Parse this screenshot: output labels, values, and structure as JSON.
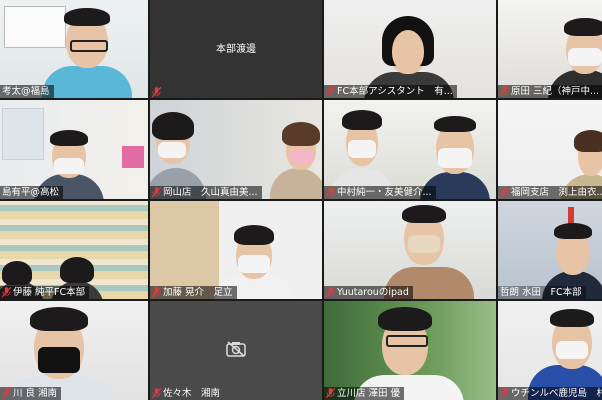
{
  "participants": [
    {
      "name": "考太@福島",
      "active": true
    },
    {
      "name": "本部渡邊",
      "camera_off_name_center": true
    },
    {
      "name": "FC本部アシスタント　有..."
    },
    {
      "name": "原田 三紀（神戸中..."
    },
    {
      "name": "島有平@高松"
    },
    {
      "name": "岡山店　久山真由美..."
    },
    {
      "name": "中村純一・友美健介..."
    },
    {
      "name": "福岡支店　渕上由衣..."
    },
    {
      "name": "伊藤 純平FC本部"
    },
    {
      "name": "加藤 晃介　足立"
    },
    {
      "name": "Yuutarouのipad"
    },
    {
      "name": "哲朗 水田　FC本部"
    },
    {
      "name": "川 良 湘南"
    },
    {
      "name": "佐々木　湘南",
      "camera_off": true
    },
    {
      "name": "立川店 澤田 優"
    },
    {
      "name": "ウチンルベ鹿児島　村..."
    }
  ],
  "icons": {
    "muted_mic": "muted-mic-icon",
    "camera_off": "camera-off-icon"
  },
  "colors": {
    "active_border": "#c5d12a",
    "muted_mic": "#e0393e",
    "tile_bg": "#3a3a3a"
  }
}
